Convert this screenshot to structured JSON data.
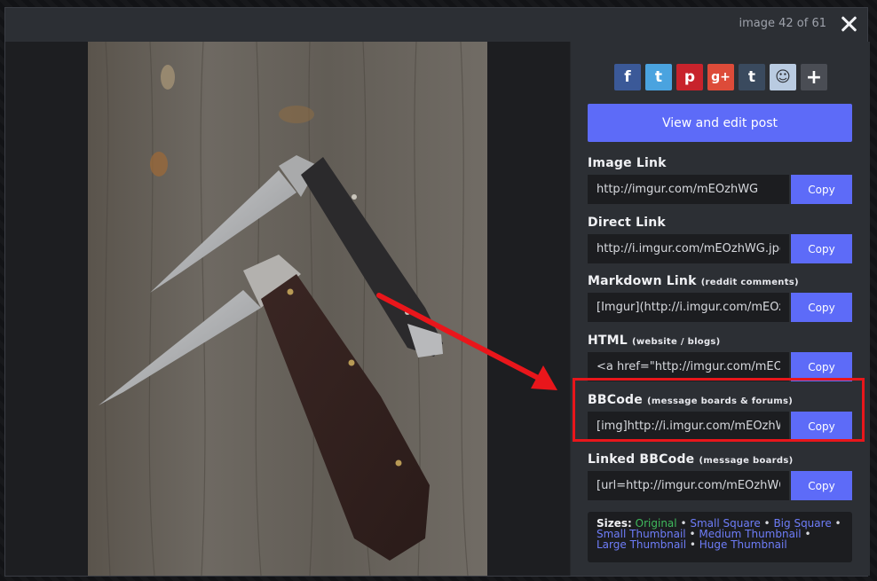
{
  "viewer": {
    "counter": "image 42 of 61"
  },
  "share": [
    {
      "name": "facebook-icon",
      "glyph": "f",
      "color": "#3b5998"
    },
    {
      "name": "twitter-icon",
      "glyph": "t",
      "color": "#4aa3df"
    },
    {
      "name": "pinterest-icon",
      "glyph": "p",
      "color": "#c8232c"
    },
    {
      "name": "google-plus-icon",
      "glyph": "g+",
      "color": "#dd4b39"
    },
    {
      "name": "tumblr-icon",
      "glyph": "t",
      "color": "#3a4a5e"
    },
    {
      "name": "reddit-icon",
      "glyph": "☺",
      "color": "#b9cbe1"
    },
    {
      "name": "more-icon",
      "glyph": "+",
      "color": "#4a4d54"
    }
  ],
  "sidebar": {
    "view_edit_label": "View and edit post",
    "copy_label": "Copy",
    "links": [
      {
        "title": "Image Link",
        "hint": "",
        "value": "http://imgur.com/mEOzhWG"
      },
      {
        "title": "Direct Link",
        "hint": "",
        "value": "http://i.imgur.com/mEOzhWG.jpg"
      },
      {
        "title": "Markdown Link",
        "hint": "(reddit comments)",
        "value": "[Imgur](http://i.imgur.com/mEOzhWG.jpg)"
      },
      {
        "title": "HTML",
        "hint": "(website / blogs)",
        "value": "<a href=\"http://imgur.com/mEOzhWG\"><img src=\"http://i.imgur.com/mEOzhWG.jpg\" title=\"source: imgur.com\" /></a>"
      },
      {
        "title": "BBCode",
        "hint": "(message boards & forums)",
        "value": "[img]http://i.imgur.com/mEOzhWG.jpg[/img]"
      },
      {
        "title": "Linked BBCode",
        "hint": "(message boards)",
        "value": "[url=http://imgur.com/mEOzhWG][img]http://i.imgur.com/mEOzhWG.jpg[/img][/url]"
      }
    ],
    "sizes": {
      "label": "Sizes:",
      "original": "Original",
      "options": [
        "Small Square",
        "Big Square",
        "Small Thumbnail",
        "Medium Thumbnail",
        "Large Thumbnail",
        "Huge Thumbnail"
      ]
    }
  },
  "colors": {
    "accent": "#5d6bf8",
    "highlight": "#e9161b",
    "original_size": "#3fb95c"
  }
}
